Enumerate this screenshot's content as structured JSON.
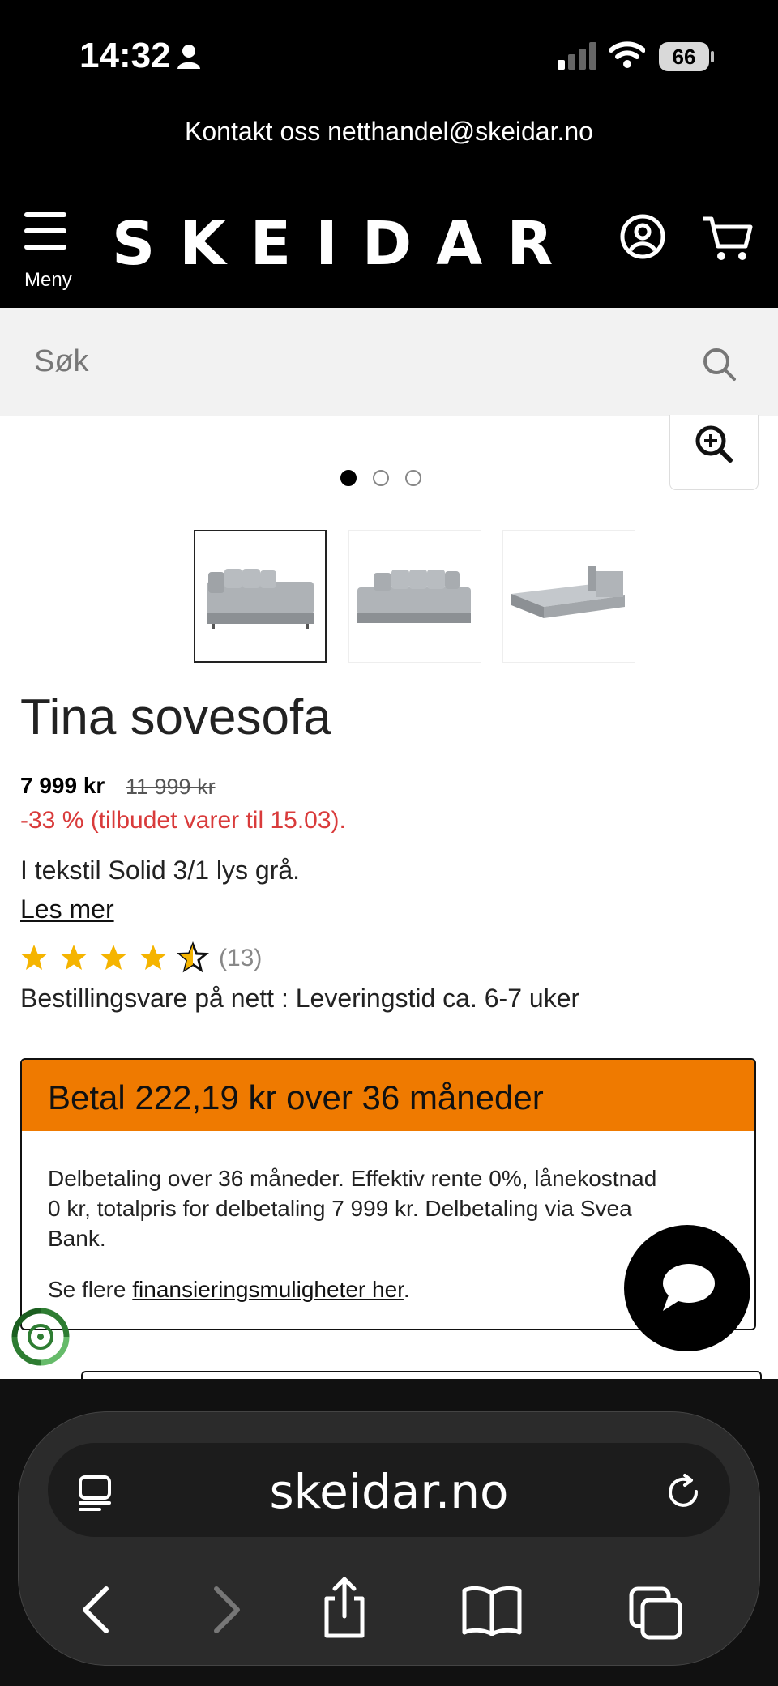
{
  "status": {
    "time": "14:32",
    "battery": "66"
  },
  "header": {
    "contact": "Kontakt oss netthandel@skeidar.no",
    "menu_label": "Meny",
    "logo": "SKEIDAR"
  },
  "search": {
    "placeholder": "Søk"
  },
  "gallery": {
    "dots": 3,
    "active_dot": 1,
    "thumbnails": [
      "sofa-chaise-gray",
      "sofa-chaise-angle",
      "sofa-bed-open"
    ]
  },
  "product": {
    "title": "Tina sovesofa",
    "price": "7 999 kr",
    "old_price": "11 999 kr",
    "discount": "-33 % (tilbudet varer til 15.03).",
    "description": "I tekstil Solid 3/1 lys grå.",
    "read_more": "Les mer",
    "rating": 4.5,
    "rating_max": 5,
    "reviews": "(13)",
    "delivery": "Bestillingsvare på nett : Leveringstid ca. 6-7 uker"
  },
  "financing": {
    "heading": "Betal 222,19 kr over 36 måneder",
    "text": "Delbetaling over 36 måneder. Effektiv rente 0%, lånekostnad 0 kr, totalpris for delbetaling 7 999 kr. Delbetaling via Svea Bank.",
    "more_prefix": "Se flere ",
    "more_link": "finansieringsmuligheter her",
    "more_suffix": "."
  },
  "browser": {
    "url": "skeidar.no"
  },
  "colors": {
    "accent": "#ef7a00",
    "discount": "#d93b3b",
    "star": "#f5b400"
  }
}
